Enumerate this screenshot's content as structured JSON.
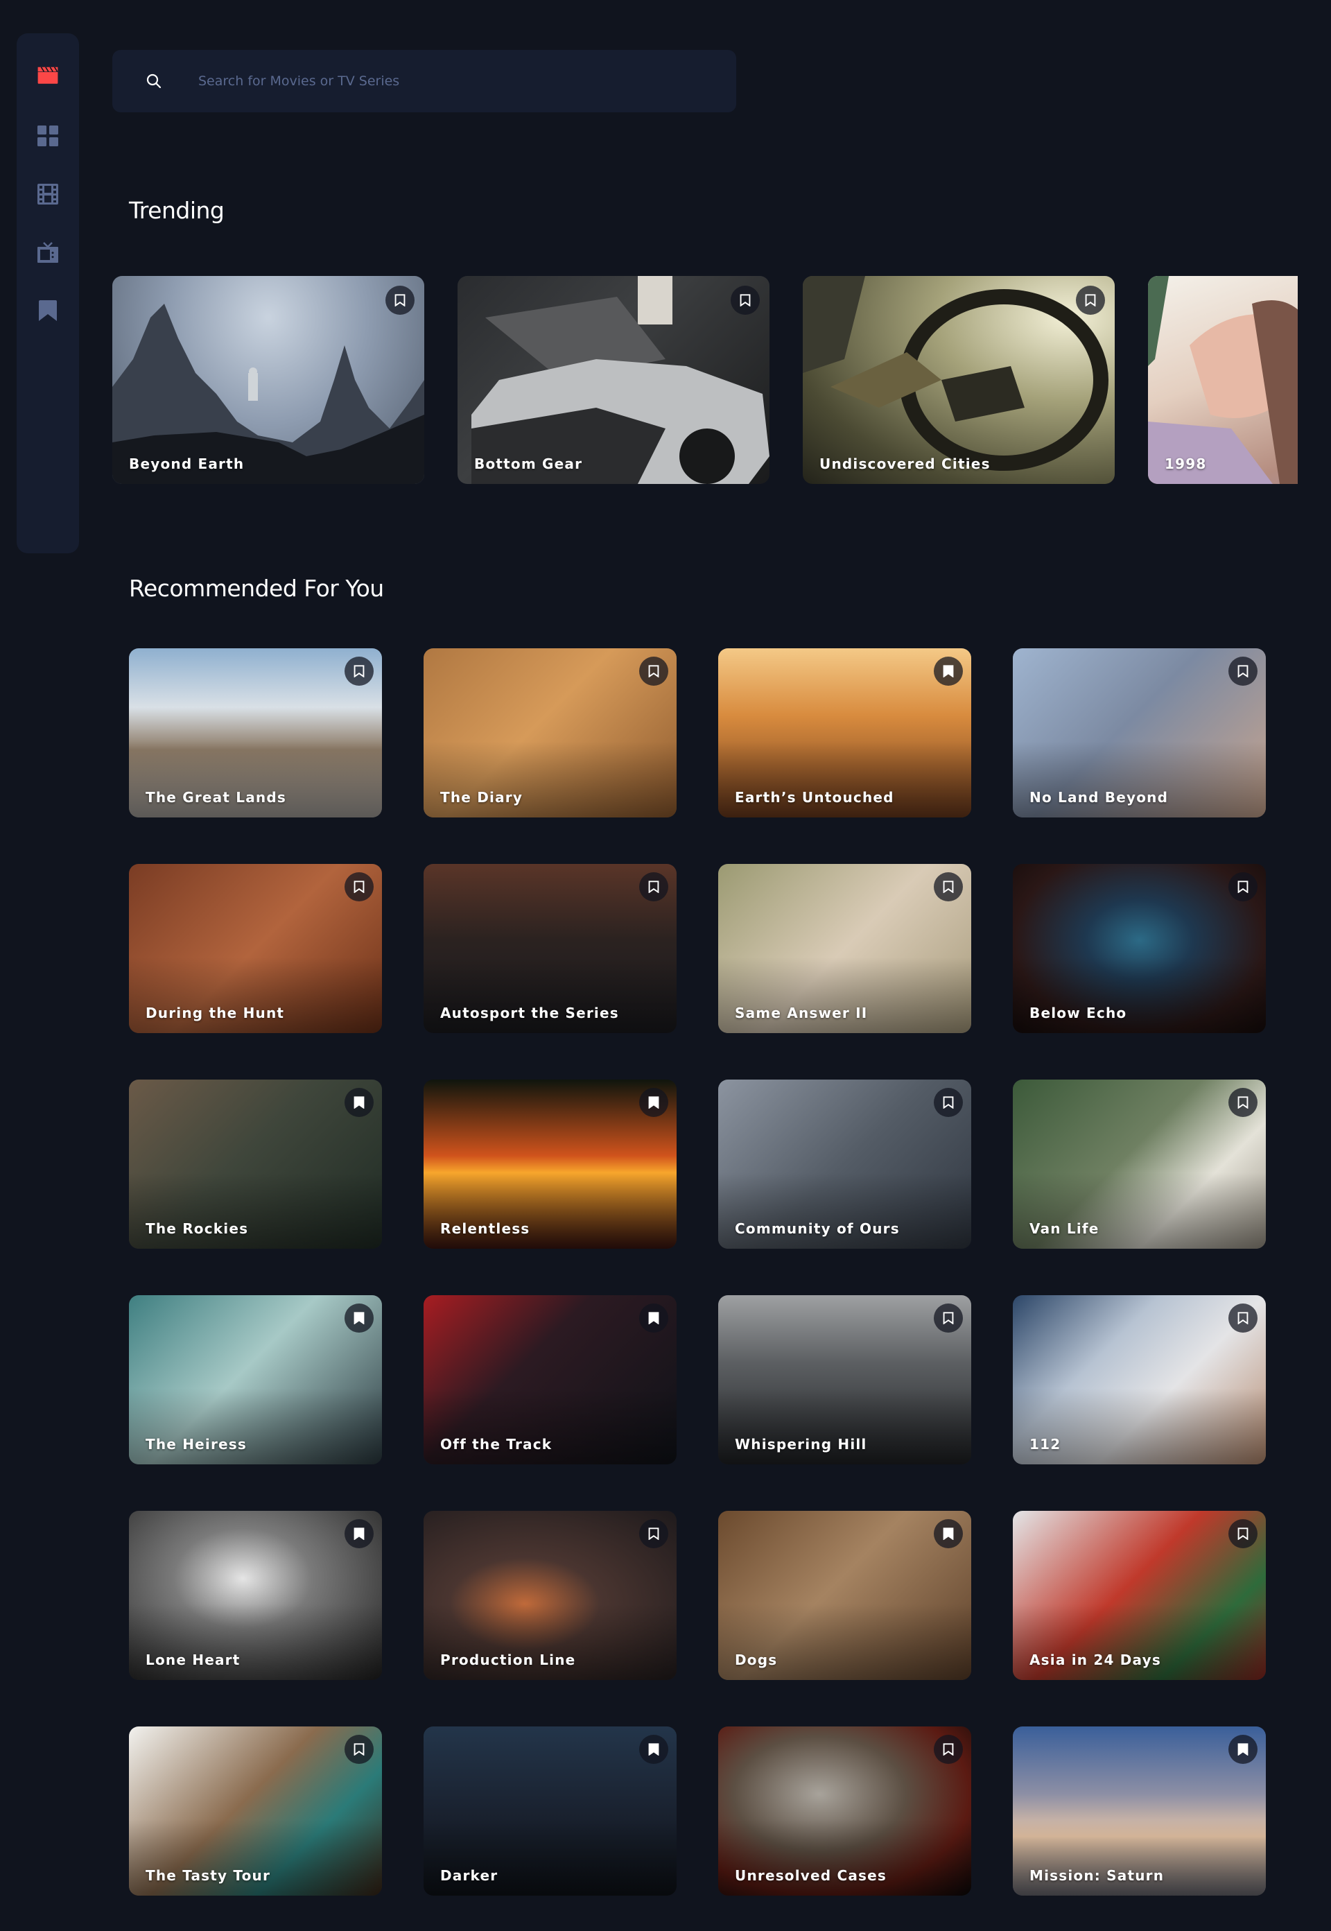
{
  "app": {
    "logo_icon": "clapperboard-icon",
    "accent_color": "#fc4747",
    "background_color": "#10141e",
    "surface_color": "#161d2f"
  },
  "nav": {
    "items": [
      {
        "icon": "grid-icon",
        "label": "Home"
      },
      {
        "icon": "film-icon",
        "label": "Movies"
      },
      {
        "icon": "tv-icon",
        "label": "TV Series"
      },
      {
        "icon": "bookmark-icon",
        "label": "Bookmarked"
      }
    ]
  },
  "search": {
    "placeholder": "Search for Movies or TV Series",
    "value": ""
  },
  "trending": {
    "title": "Trending",
    "items": [
      {
        "title": "Beyond Earth",
        "bookmarked": false
      },
      {
        "title": "Bottom Gear",
        "bookmarked": false
      },
      {
        "title": "Undiscovered Cities",
        "bookmarked": false
      },
      {
        "title": "1998",
        "bookmarked": false
      }
    ]
  },
  "recommended": {
    "title": "Recommended For You",
    "items": [
      {
        "title": "The Great Lands",
        "bookmarked": false
      },
      {
        "title": "The Diary",
        "bookmarked": false
      },
      {
        "title": "Earth’s Untouched",
        "bookmarked": true
      },
      {
        "title": "No Land Beyond",
        "bookmarked": false
      },
      {
        "title": "During the Hunt",
        "bookmarked": false
      },
      {
        "title": "Autosport the Series",
        "bookmarked": false
      },
      {
        "title": "Same Answer II",
        "bookmarked": false
      },
      {
        "title": "Below Echo",
        "bookmarked": false
      },
      {
        "title": "The Rockies",
        "bookmarked": true
      },
      {
        "title": "Relentless",
        "bookmarked": true
      },
      {
        "title": "Community of Ours",
        "bookmarked": false
      },
      {
        "title": "Van Life",
        "bookmarked": false
      },
      {
        "title": "The Heiress",
        "bookmarked": true
      },
      {
        "title": "Off the Track",
        "bookmarked": true
      },
      {
        "title": "Whispering Hill",
        "bookmarked": false
      },
      {
        "title": "112",
        "bookmarked": false
      },
      {
        "title": "Lone Heart",
        "bookmarked": true
      },
      {
        "title": "Production Line",
        "bookmarked": false
      },
      {
        "title": "Dogs",
        "bookmarked": true
      },
      {
        "title": "Asia in 24 Days",
        "bookmarked": false
      },
      {
        "title": "The Tasty Tour",
        "bookmarked": false
      },
      {
        "title": "Darker",
        "bookmarked": true
      },
      {
        "title": "Unresolved Cases",
        "bookmarked": false
      },
      {
        "title": "Mission: Saturn",
        "bookmarked": true
      }
    ]
  }
}
